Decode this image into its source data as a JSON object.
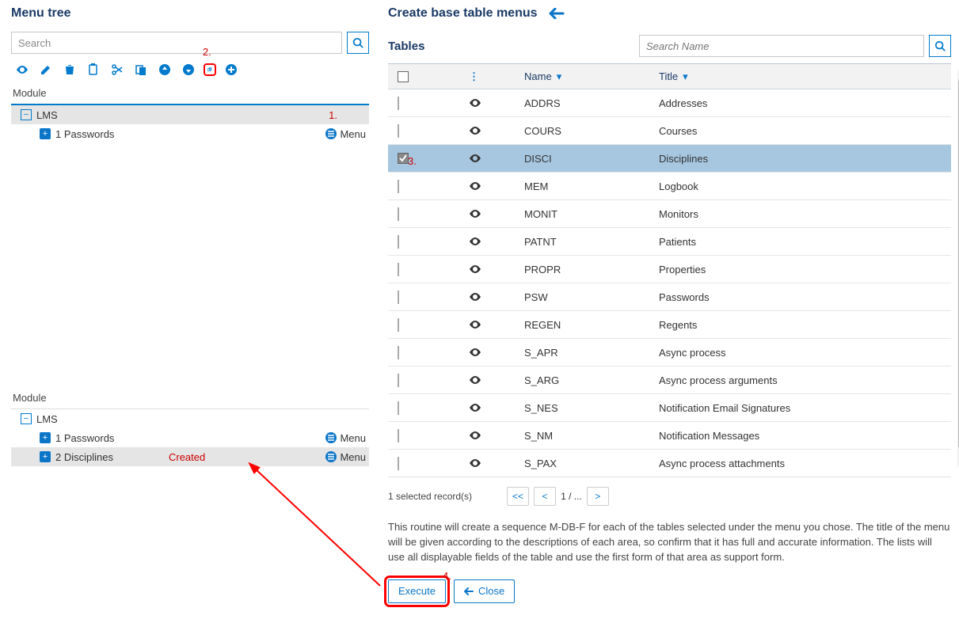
{
  "left": {
    "title": "Menu tree",
    "search_placeholder": "Search",
    "module_label": "Module",
    "annot2": "2.",
    "annot1": "1.",
    "tree1": {
      "root": "LMS",
      "child1": {
        "label": "1 Passwords",
        "badge": "Menu"
      }
    },
    "tree2": {
      "root": "LMS",
      "child1": {
        "label": "1 Passwords",
        "badge": "Menu"
      },
      "child2": {
        "label": "2 Disciplines",
        "created": "Created",
        "badge": "Menu"
      }
    }
  },
  "right": {
    "title": "Create base table menus",
    "tables_label": "Tables",
    "search_placeholder": "Search Name",
    "col_name": "Name",
    "col_title": "Title",
    "annot3": "3.",
    "annot4": "4.",
    "rows": [
      {
        "name": "ADDRS",
        "title": "Addresses",
        "selected": false
      },
      {
        "name": "COURS",
        "title": "Courses",
        "selected": false
      },
      {
        "name": "DISCI",
        "title": "Disciplines",
        "selected": true
      },
      {
        "name": "MEM",
        "title": "Logbook",
        "selected": false
      },
      {
        "name": "MONIT",
        "title": "Monitors",
        "selected": false
      },
      {
        "name": "PATNT",
        "title": "Patients",
        "selected": false
      },
      {
        "name": "PROPR",
        "title": "Properties",
        "selected": false
      },
      {
        "name": "PSW",
        "title": "Passwords",
        "selected": false
      },
      {
        "name": "REGEN",
        "title": "Regents",
        "selected": false
      },
      {
        "name": "S_APR",
        "title": "Async process",
        "selected": false
      },
      {
        "name": "S_ARG",
        "title": "Async process arguments",
        "selected": false
      },
      {
        "name": "S_NES",
        "title": "Notification Email Signatures",
        "selected": false
      },
      {
        "name": "S_NM",
        "title": "Notification Messages",
        "selected": false
      },
      {
        "name": "S_PAX",
        "title": "Async process attachments",
        "selected": false
      }
    ],
    "selected_count": "1 selected record(s)",
    "pager": {
      "first": "<<",
      "prev": "<",
      "page": "1 / ...",
      "next": ">"
    },
    "description": "This routine will create a sequence M-DB-F for each of the tables selected under the menu you chose. The title of the menu will be given according to the descriptions of each area, so confirm that it has full and accurate information. The lists will use all displayable fields of the table and use the first form of that area as support form.",
    "execute": "Execute",
    "close": "Close"
  }
}
